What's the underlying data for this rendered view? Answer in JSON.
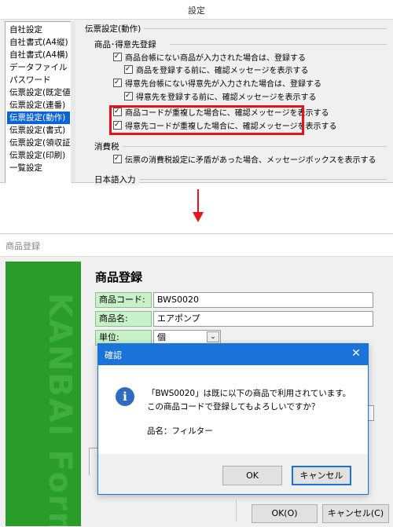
{
  "settings_window": {
    "title": "設定",
    "sidebar_items": [
      {
        "label": "自社設定",
        "selected": false
      },
      {
        "label": "自社書式(A4縦)",
        "selected": false
      },
      {
        "label": "自社書式(A4横)",
        "selected": false
      },
      {
        "label": "データファイル",
        "selected": false
      },
      {
        "label": "パスワード",
        "selected": false
      },
      {
        "label": "伝票設定(既定値)",
        "selected": false
      },
      {
        "label": "伝票設定(連番)",
        "selected": false
      },
      {
        "label": "伝票設定(動作)",
        "selected": true
      },
      {
        "label": "伝票設定(書式)",
        "selected": false
      },
      {
        "label": "伝票設定(領収証)",
        "selected": false
      },
      {
        "label": "伝票設定(印刷)",
        "selected": false
      },
      {
        "label": "一覧設定",
        "selected": false
      }
    ],
    "panel_title": "伝票設定(動作)",
    "section_product": "商品･得意先登録",
    "options": [
      "商品台帳にない商品が入力された場合は、登録する",
      "商品を登録する前に、確認メッセージを表示する",
      "得意先台帳にない得意先が入力された場合は、登録する",
      "得意先を登録する前に、確認メッセージを表示する",
      "商品コードが重複した場合に、確認メッセージを表示する",
      "得意先コードが重複した場合に、確認メッセージを表示する"
    ],
    "section_tax": "消費税",
    "tax_option": "伝票の消費税設定に矛盾があった場合、メッセージボックスを表示する",
    "section_next": "日本語入力",
    "highlight_color": "#e4141b",
    "selection_color": "#0a64d3"
  },
  "product_window": {
    "title": "商品登録",
    "heading": "商品登録",
    "code_label": "商品コード:",
    "code_value": "BWS0020",
    "name_label": "商品名:",
    "name_value": "エアポンプ",
    "unit_label": "単位:",
    "unit_value": "個",
    "side_brand": "KANBAI Formulas",
    "ok_button": "OK(O)",
    "cancel_button": "キャンセル(C)",
    "brand_color": "#2a9c2a"
  },
  "confirm_dialog": {
    "title": "確認",
    "close_icon": "close-icon",
    "icon": "info-icon",
    "message_line1": "「BWS0020」は既に以下の商品で利用されています。",
    "message_line2": "この商品コードで登録してもよろしいですか？",
    "detail": "品名：フィルター",
    "ok_button": "OK",
    "cancel_button": "キャンセル",
    "accent_color": "#1a73d9"
  }
}
